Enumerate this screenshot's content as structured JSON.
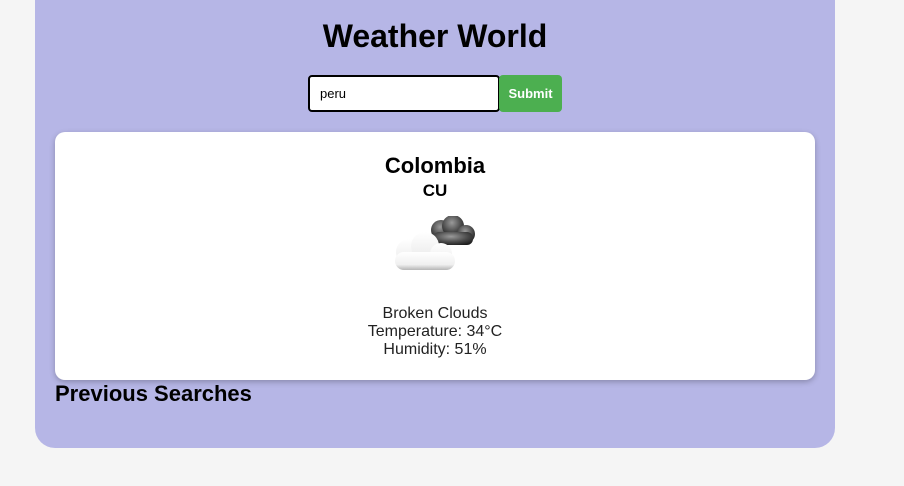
{
  "app": {
    "title": "Weather World",
    "background_color": "#b6b6e6"
  },
  "search": {
    "value": "peru",
    "submit_label": "Submit",
    "submit_color": "#4caf50"
  },
  "weather": {
    "city": "Colombia",
    "country_code": "CU",
    "icon": "broken-clouds-icon",
    "description": "Broken Clouds",
    "temperature": "Temperature: 34°C",
    "humidity": "Humidity: 51%"
  },
  "history": {
    "heading": "Previous Searches"
  }
}
